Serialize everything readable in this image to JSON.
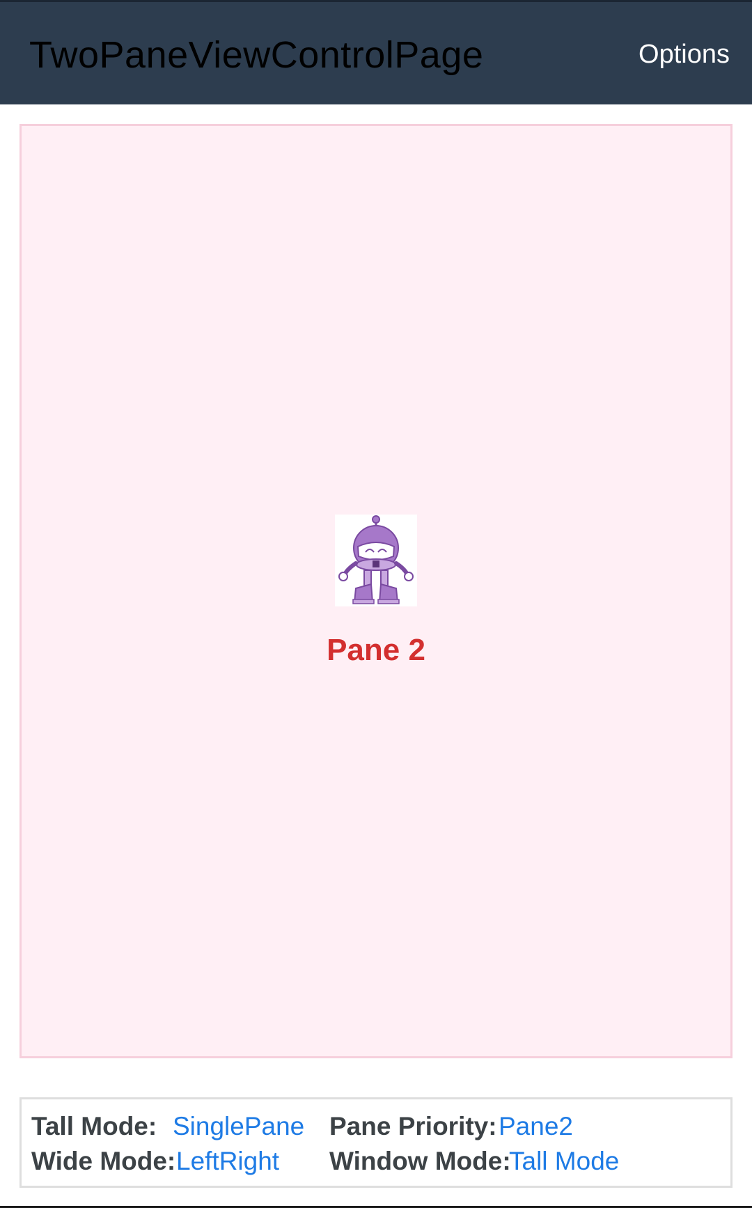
{
  "app_bar": {
    "title": "TwoPaneViewControlPage",
    "options_label": "Options"
  },
  "pane": {
    "image_icon": "dotnet-bot-icon",
    "title": "Pane 2"
  },
  "info": {
    "tall_mode_label": "Tall Mode:",
    "tall_mode_value": "SinglePane",
    "pane_priority_label": "Pane Priority:",
    "pane_priority_value": "Pane2",
    "wide_mode_label": "Wide Mode:",
    "wide_mode_value": "LeftRight",
    "window_mode_label": "Window Mode:",
    "window_mode_value": "Tall Mode"
  },
  "colors": {
    "app_bar_bg": "#2d3d4f",
    "pane_bg": "#ffeff5",
    "pane_border": "#f6cfdc",
    "pane_title": "#d32f2f",
    "link_value": "#1e7be5",
    "bot_purple": "#a678c9"
  }
}
